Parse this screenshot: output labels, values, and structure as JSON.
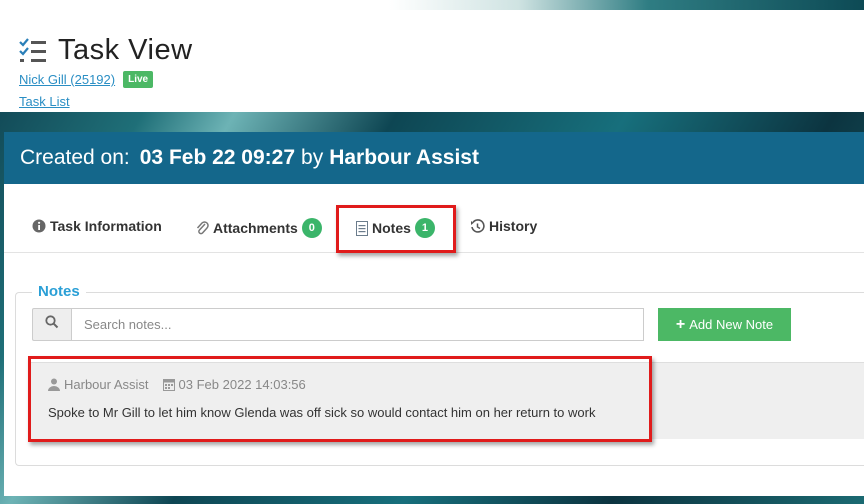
{
  "header": {
    "title": "Task View",
    "user_link": "Nick Gill (25192)",
    "status_badge": "Live",
    "task_list_link": "Task List"
  },
  "created": {
    "prefix": "Created on:",
    "datetime": "03 Feb 22 09:27",
    "by": "by",
    "author": "Harbour Assist"
  },
  "tabs": [
    {
      "label": "Task Information",
      "icon": "info-icon"
    },
    {
      "label": "Attachments",
      "icon": "paperclip-icon",
      "count": "0"
    },
    {
      "label": "Notes",
      "icon": "document-icon",
      "count": "1"
    },
    {
      "label": "History",
      "icon": "history-icon"
    }
  ],
  "notes": {
    "legend": "Notes",
    "search_placeholder": "Search notes...",
    "add_button": "Add New Note",
    "items": [
      {
        "author": "Harbour Assist",
        "date": "03 Feb 2022 14:03:56",
        "text": "Spoke to Mr Gill to let him know Glenda was off sick so would contact him on her return to work"
      }
    ]
  },
  "colors": {
    "accent_blue": "#14678b",
    "success_green": "#4cb865",
    "link_blue": "#2a8ec4",
    "highlight_red": "#e01b1b"
  }
}
